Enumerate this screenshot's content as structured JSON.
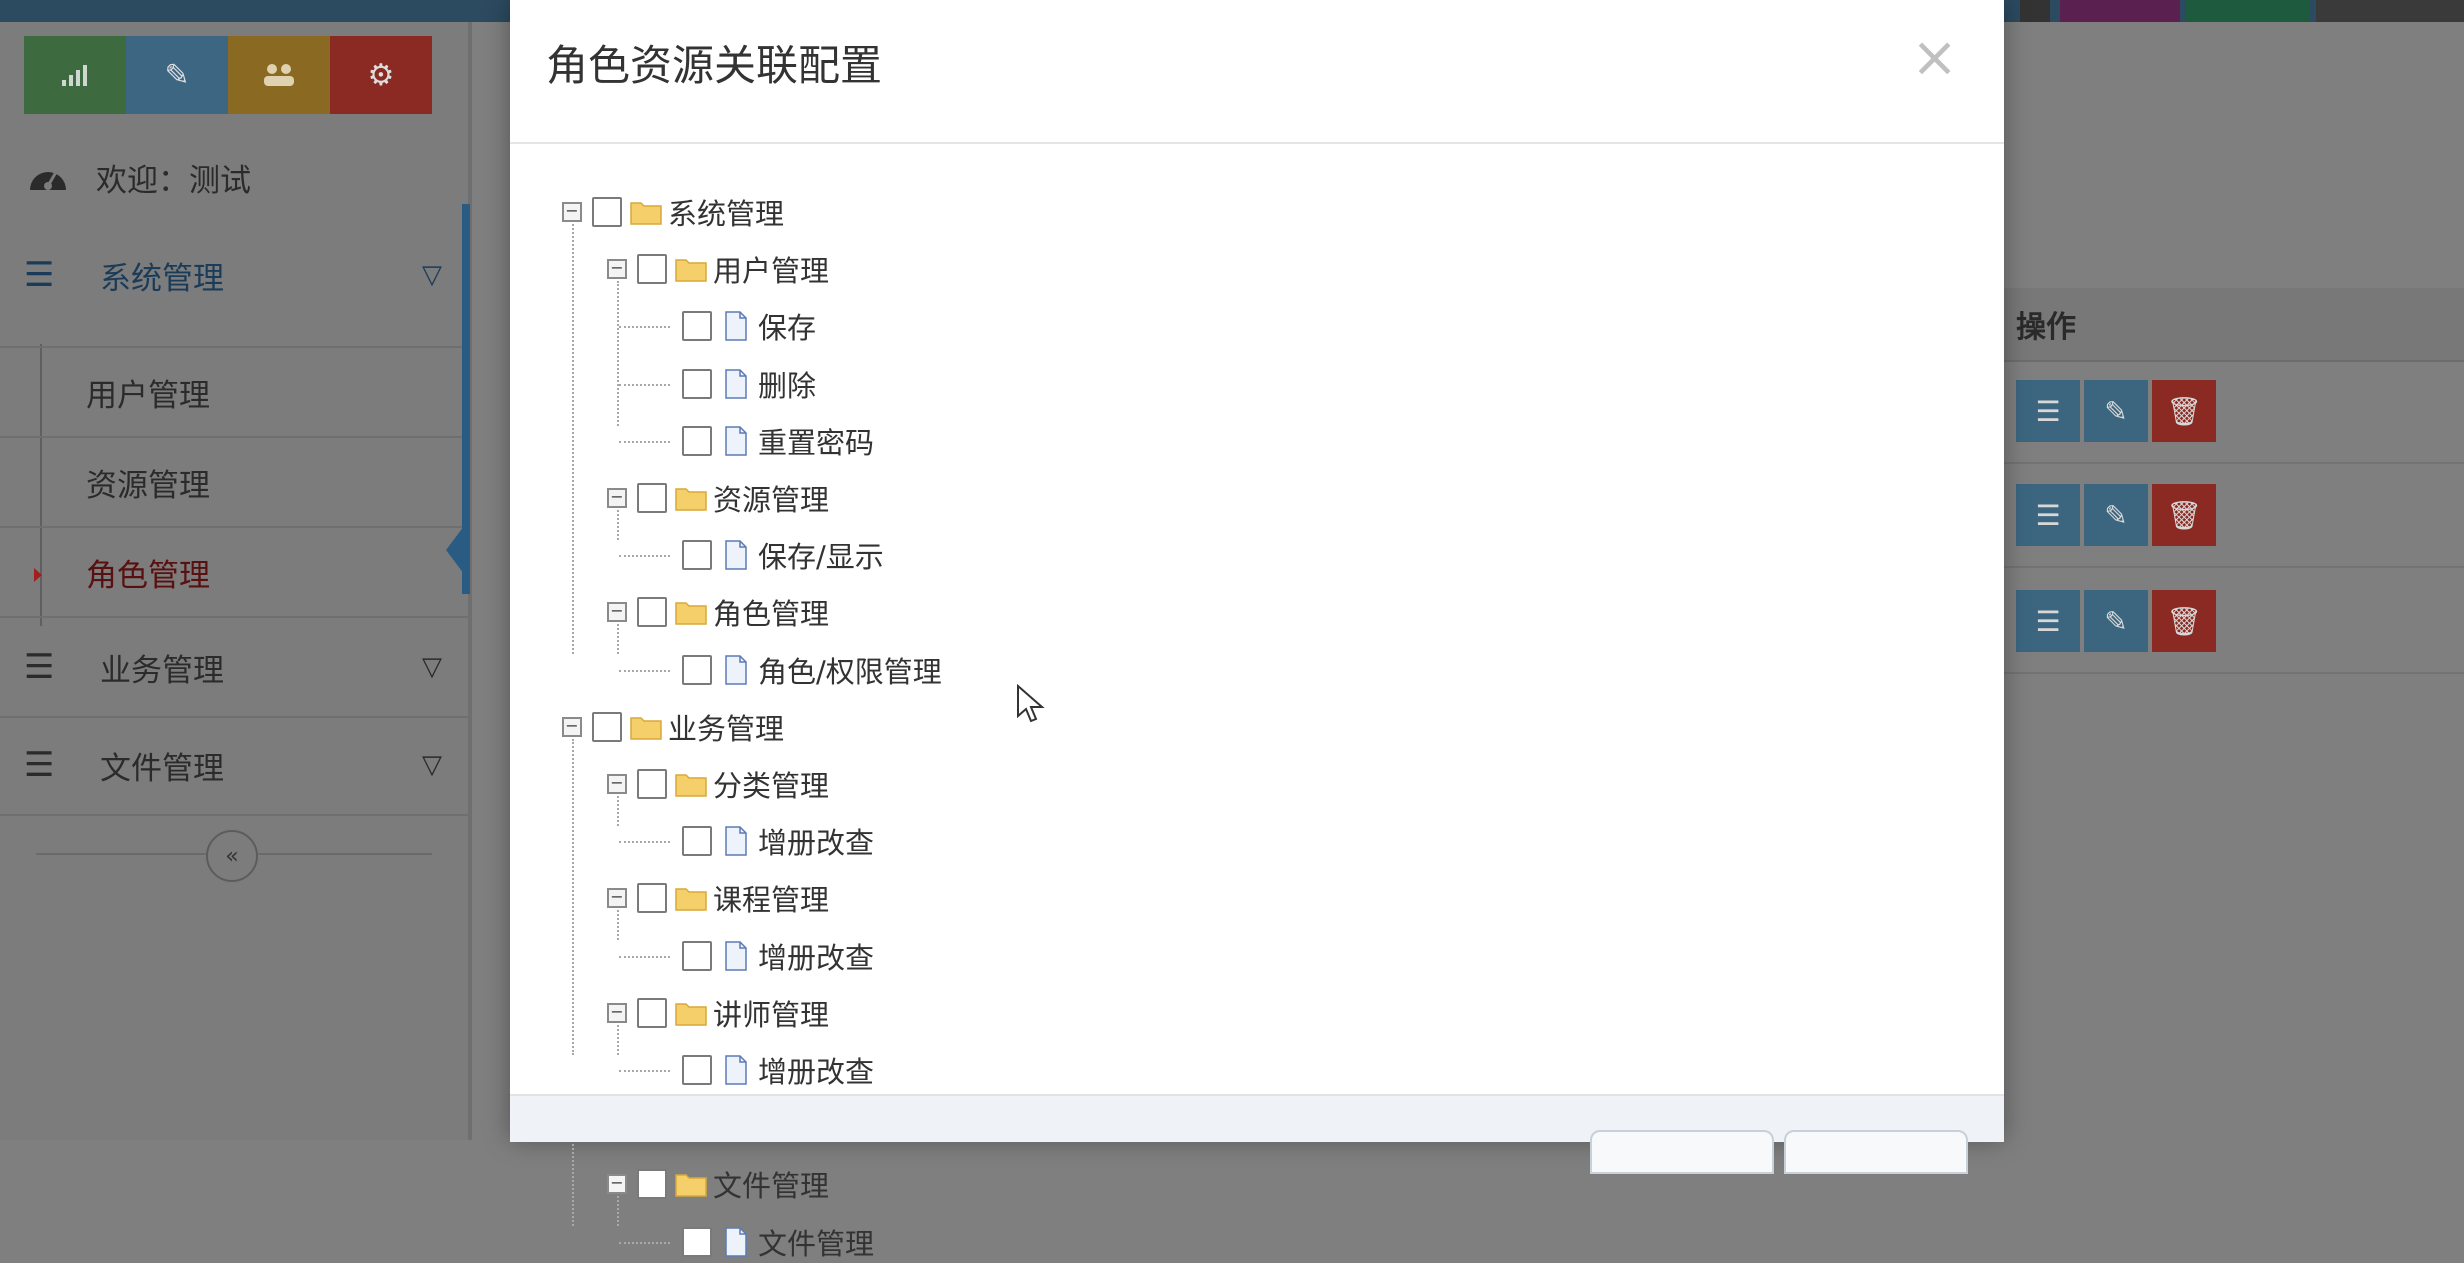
{
  "colors": {
    "modal_bg": "#ffffff",
    "folder": "#f5cf6a",
    "file": "#c9d6ea",
    "overlay": "#7f7f7f",
    "accent": "#2a5b82",
    "delete": "#8a2a22"
  },
  "shortcuts": [
    {
      "icon": "signal-icon",
      "color": "#3d6b3f"
    },
    {
      "icon": "pencil-icon",
      "color": "#3d6682"
    },
    {
      "icon": "group-icon",
      "color": "#8a6a22"
    },
    {
      "icon": "cogs-icon",
      "color": "#8a2a22"
    }
  ],
  "sidebar": {
    "welcome": "欢迎：测试",
    "menus": [
      {
        "label": "系统管理",
        "open": true,
        "children": [
          "用户管理",
          "资源管理",
          "角色管理"
        ],
        "active_child": "角色管理"
      },
      {
        "label": "业务管理",
        "open": false
      },
      {
        "label": "文件管理",
        "open": false
      }
    ],
    "collapse_label": "«"
  },
  "table": {
    "ops_header": "操作",
    "row_count": 3
  },
  "modal": {
    "title": "角色资源关联配置",
    "close": "×",
    "tree": [
      {
        "label": "系统管理",
        "children": [
          {
            "label": "用户管理",
            "children": [
              {
                "label": "保存"
              },
              {
                "label": "删除"
              },
              {
                "label": "重置密码"
              }
            ]
          },
          {
            "label": "资源管理",
            "children": [
              {
                "label": "保存/显示"
              }
            ]
          },
          {
            "label": "角色管理",
            "children": [
              {
                "label": "角色/权限管理"
              }
            ]
          }
        ]
      },
      {
        "label": "业务管理",
        "children": [
          {
            "label": "分类管理",
            "children": [
              {
                "label": "增册改查"
              }
            ]
          },
          {
            "label": "课程管理",
            "children": [
              {
                "label": "增册改查"
              }
            ]
          },
          {
            "label": "讲师管理",
            "children": [
              {
                "label": "增册改查"
              }
            ]
          }
        ]
      },
      {
        "label": "文件管理",
        "children": [
          {
            "label": "文件管理",
            "children": [
              {
                "label": "文件管理"
              }
            ]
          }
        ]
      }
    ]
  }
}
